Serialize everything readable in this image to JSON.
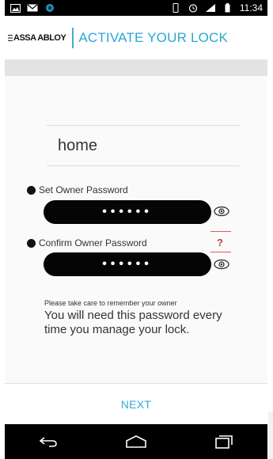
{
  "status_bar": {
    "time": "11:34"
  },
  "app_bar": {
    "logo_text": "ASSA ABLOY",
    "title": "ACTIVATE YOUR LOCK"
  },
  "form": {
    "lock_name_value": "home",
    "owner_password": {
      "label": "Set Owner Password",
      "masked_value": "••••••"
    },
    "confirm_password": {
      "label": "Confirm Owner Password",
      "masked_value": "••••••",
      "help_text": "?"
    },
    "note_small": "Please take care to remember your owner",
    "note_big": "You will need this password every time you manage your lock."
  },
  "footer": {
    "next_label": "NEXT"
  },
  "colors": {
    "accent": "#2aa6d5",
    "pill": "#050505",
    "warning": "#c64040"
  },
  "icons": {
    "menu": "menu-icon",
    "eye": "eye-icon",
    "back": "back-icon",
    "home": "home-icon",
    "recents": "recents-icon"
  }
}
